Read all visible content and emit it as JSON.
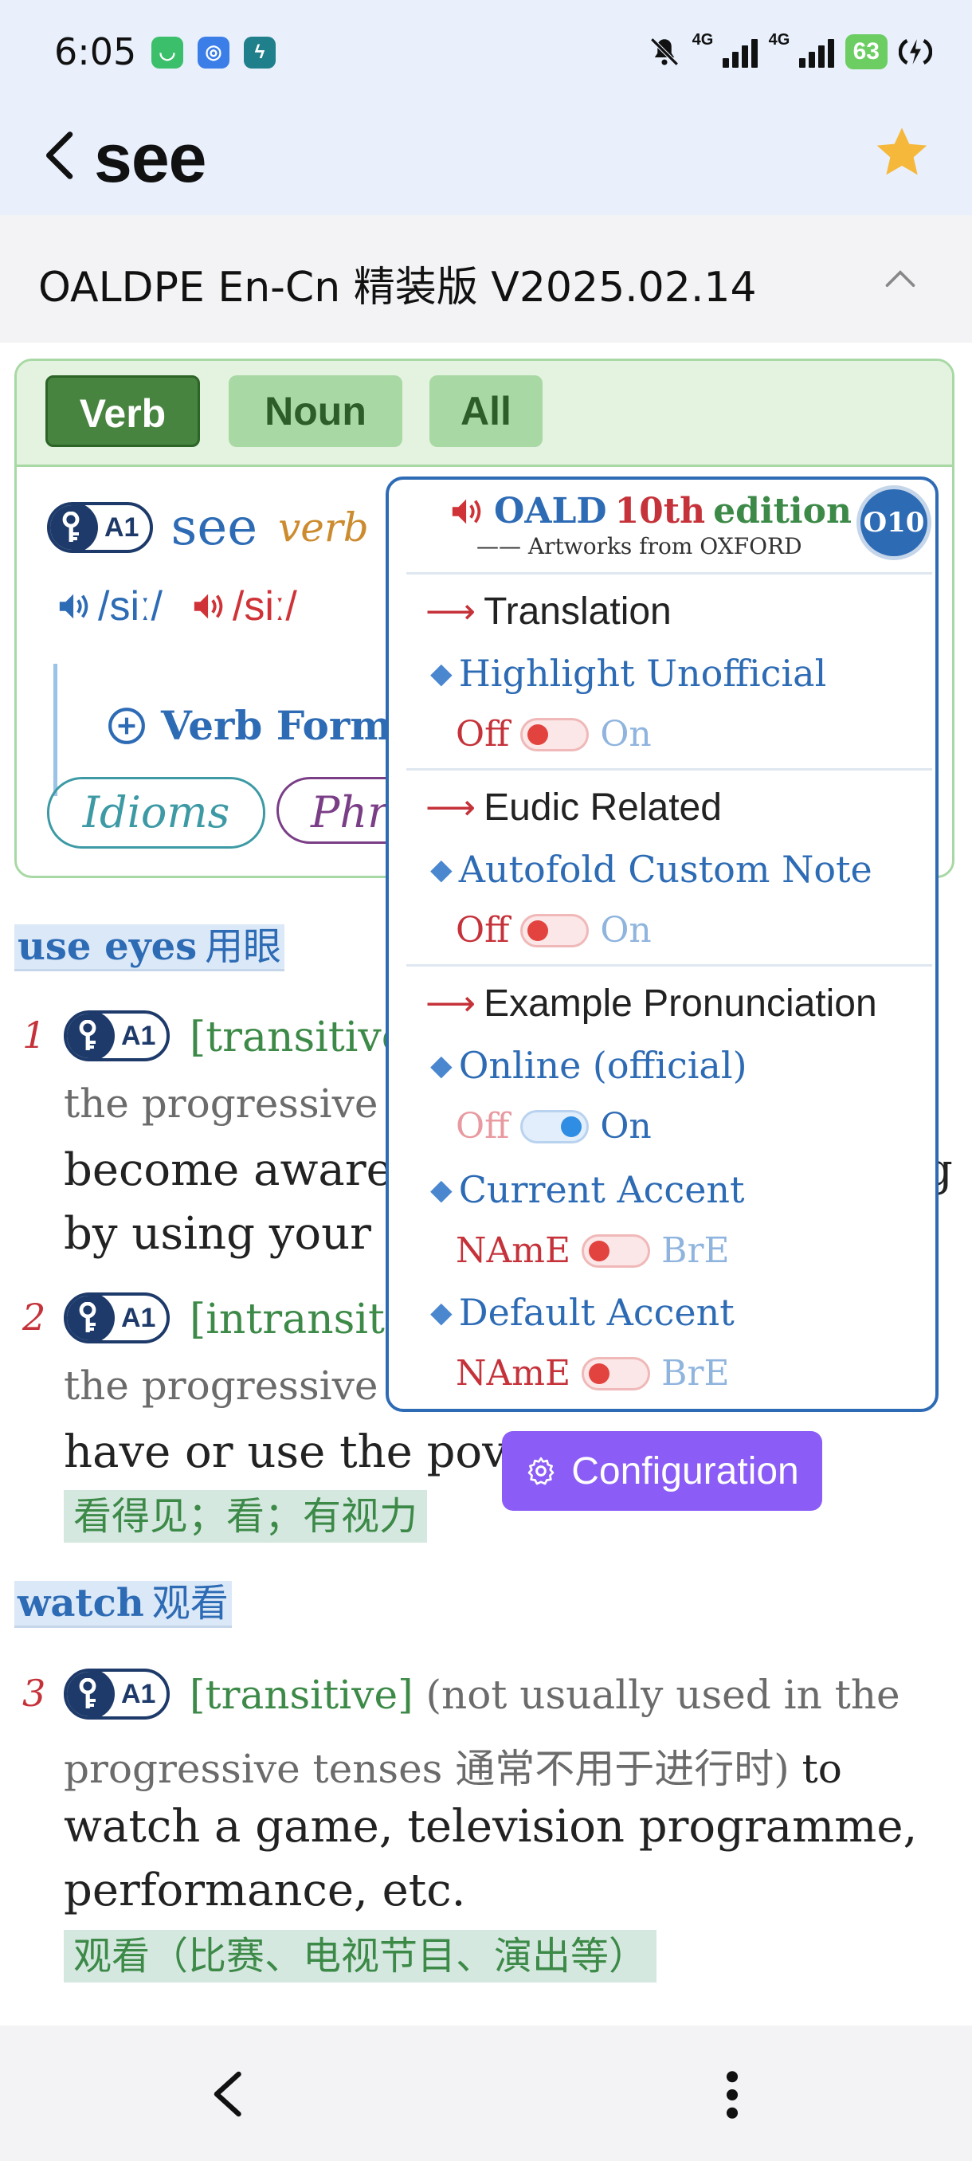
{
  "status_bar": {
    "time": "6:05",
    "signal_label_1": "4G",
    "signal_label_2": "4G",
    "battery": "63",
    "icons": [
      "app-green-icon",
      "app-blue-icon",
      "app-teal-icon",
      "mute-bell-icon",
      "signal-icon",
      "signal-icon",
      "battery-icon",
      "charging-icon"
    ]
  },
  "header": {
    "title": "see",
    "back_icon": "chevron-left-icon",
    "star_icon": "star-icon",
    "star_color": "#f5b83a"
  },
  "dictionary": {
    "name": "OALDPE En-Cn 精装版 V2025.02.14"
  },
  "tabs": {
    "verb": "Verb",
    "noun": "Noun",
    "all": "All"
  },
  "entry": {
    "level": "A1",
    "headword": "see",
    "pos": "verb",
    "pron_uk": "/siː/",
    "pron_us": "/siː/",
    "verb_forms": "Verb Forms",
    "idioms": "Idioms",
    "phrasal": "Phr"
  },
  "senses": {
    "group1": {
      "en": "use eyes",
      "zh": "用眼"
    },
    "s1": {
      "num": "1",
      "level": "A1",
      "line1": "[transitive",
      "line2": "the progressive",
      "line3": "become aware",
      "line3_right": "g",
      "line4": "by using your"
    },
    "s2": {
      "num": "2",
      "level": "A1",
      "line1": "[intransiti",
      "line2": "the progressive",
      "line3": "have or use the pov",
      "zh": "看得见；看；有视力"
    },
    "group2": {
      "en": "watch",
      "zh": "观看"
    },
    "s3": {
      "num": "3",
      "level": "A1",
      "gram": "[transitive]",
      "note1": "(not usually used in the",
      "note2": "progressive tenses 通常不用于进行时)",
      "def1": "to",
      "def2": "watch a game, television programme,",
      "def3": "performance, etc.",
      "zh": "观看（比赛、电视节目、演出等）"
    }
  },
  "popup": {
    "title_oald": "OALD",
    "title_10th": "10th",
    "title_edition": "edition",
    "subtitle": "—— Artworks from OXFORD",
    "badge": "O10",
    "sec_translation": "Translation",
    "opt_highlight": "Highlight Unofficial",
    "sec_eudic": "Eudic Related",
    "opt_autofold": "Autofold Custom Note",
    "sec_example": "Example Pronunciation",
    "opt_online": "Online (official)",
    "opt_current_accent": "Current Accent",
    "opt_default_accent": "Default Accent",
    "off": "Off",
    "on": "On",
    "name": "NAmE",
    "bre": "BrE",
    "toggles": {
      "highlight_unofficial": false,
      "autofold_custom_note": false,
      "online_official": true,
      "current_accent_bre": false,
      "default_accent_bre": false
    },
    "arrow": "⟶",
    "diamond": "◆"
  },
  "config_button": {
    "label": "Configuration",
    "color": "#8b5cf6"
  },
  "nav": {
    "back_icon": "chevron-left-icon",
    "more_icon": "more-vertical-icon"
  }
}
